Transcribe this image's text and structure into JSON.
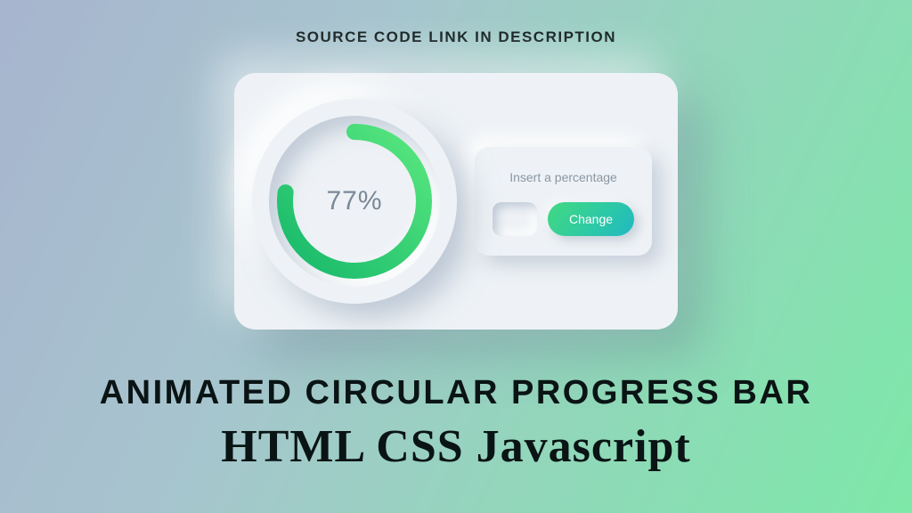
{
  "banner": {
    "top": "SOURCE CODE LINK IN DESCRIPTION",
    "title": "ANIMATED CIRCULAR PROGRESS BAR",
    "subtitle": "HTML CSS Javascript"
  },
  "progress": {
    "percent": 77,
    "percent_text": "77%",
    "stroke_gradient_start": "#16b86b",
    "stroke_gradient_end": "#5ae87f"
  },
  "controls": {
    "label": "Insert a percentage",
    "button_label": "Change",
    "input_value": ""
  }
}
